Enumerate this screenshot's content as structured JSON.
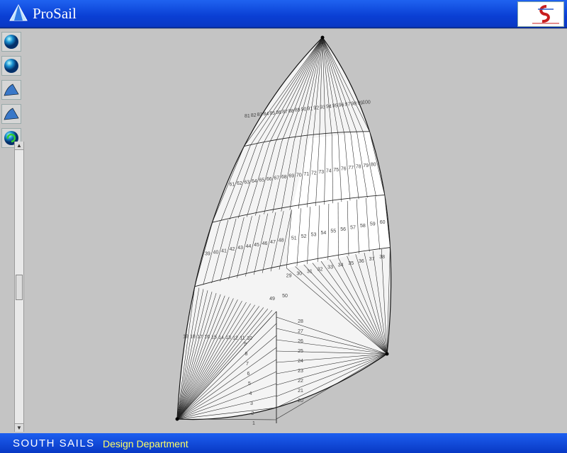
{
  "window": {
    "title": "ProSail"
  },
  "toolbar": {
    "buttons": [
      {
        "name": "globe-view-1-button",
        "icon": "globe-icon"
      },
      {
        "name": "globe-view-2-button",
        "icon": "globe-icon"
      },
      {
        "name": "sail-view-1-button",
        "icon": "sail-icon"
      },
      {
        "name": "sail-view-2-button",
        "icon": "sail-icon"
      },
      {
        "name": "refresh-button",
        "icon": "refresh-globe-icon"
      }
    ]
  },
  "status": {
    "company": "SOUTH SAILS",
    "department": "Design Department"
  },
  "colors": {
    "titlebar": "#0a3fd4",
    "status_highlight": "#ffff66"
  },
  "panels": {
    "row0": [
      "1",
      "2",
      "3",
      "4",
      "5",
      "6",
      "7",
      "8",
      "9",
      "10",
      "11",
      "12",
      "13",
      "14",
      "15",
      "16",
      "17",
      "18",
      "19"
    ],
    "row0_right": [
      "20",
      "21",
      "22",
      "23",
      "24",
      "25",
      "26",
      "27",
      "28"
    ],
    "row1": [
      "29",
      "30",
      "31",
      "32",
      "33",
      "34",
      "35",
      "36",
      "37",
      "38"
    ],
    "row2_left": [
      "39",
      "40",
      "41",
      "42",
      "43",
      "44",
      "45",
      "46",
      "47",
      "48"
    ],
    "row2_mid": [
      "49",
      "50"
    ],
    "row2_right": [
      "51",
      "52",
      "53",
      "54",
      "55",
      "56",
      "57",
      "58",
      "59",
      "60"
    ],
    "row3": [
      "61",
      "62",
      "63",
      "64",
      "65",
      "66",
      "67",
      "68",
      "69",
      "70",
      "71",
      "72",
      "73",
      "74",
      "75",
      "76",
      "77",
      "78",
      "79",
      "80"
    ],
    "row4": [
      "81",
      "82",
      "83",
      "84",
      "85",
      "86",
      "87",
      "88",
      "89",
      "90",
      "91",
      "92",
      "93",
      "94",
      "95",
      "96",
      "97",
      "98",
      "99",
      "100"
    ]
  }
}
